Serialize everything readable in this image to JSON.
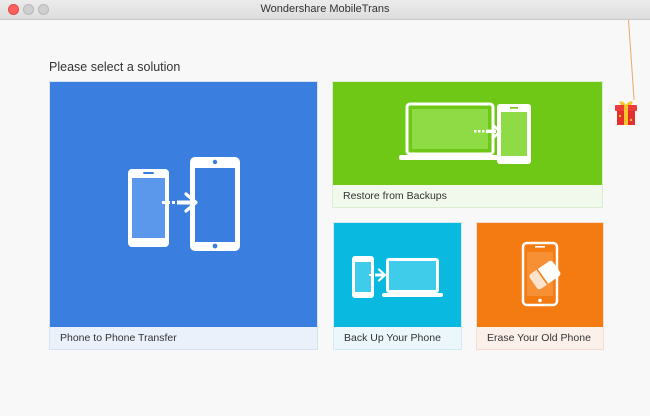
{
  "window": {
    "title": "Wondershare MobileTrans"
  },
  "main": {
    "heading": "Please select a solution",
    "cards": {
      "phone_to_phone": {
        "label": "Phone to Phone Transfer",
        "color": "#3a7fdf"
      },
      "restore": {
        "label": "Restore from Backups",
        "color": "#6ec815"
      },
      "backup": {
        "label": "Back Up Your Phone",
        "color": "#0ab9e0"
      },
      "erase": {
        "label": "Erase Your Old Phone",
        "color": "#f47b12"
      }
    }
  },
  "icons": {
    "window_controls": [
      "close-icon",
      "minimize-icon",
      "maximize-icon"
    ],
    "decoration": "gift-icon"
  }
}
